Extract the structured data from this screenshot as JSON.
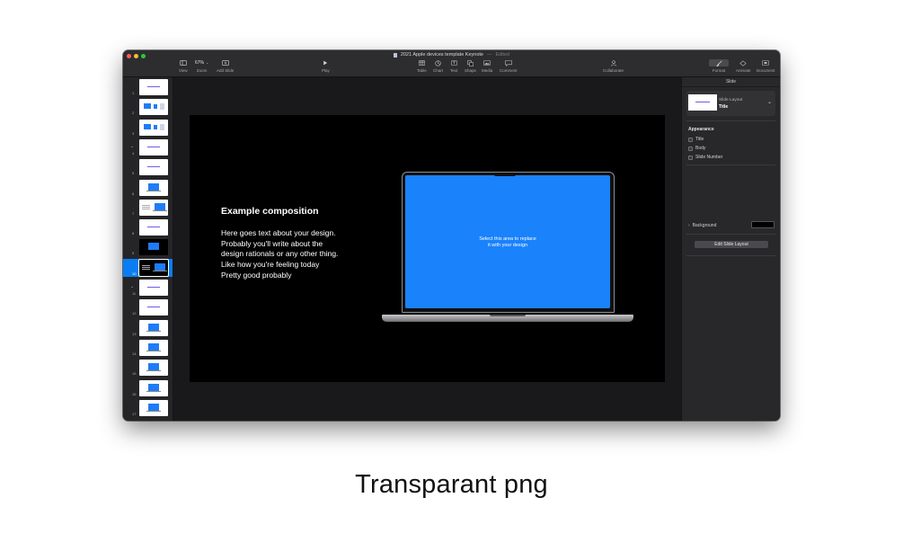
{
  "window": {
    "title": "2021 Apple devices template Keynote",
    "title_separator": "—",
    "status": "Edited",
    "traffic_lights": {
      "close": "#fe5f57",
      "minimize": "#febc2e",
      "zoom": "#28c840"
    }
  },
  "toolbar": {
    "view_label": "View",
    "zoom_value": "67%",
    "zoom_label": "Zoom",
    "add_slide_label": "Add Slide",
    "play_label": "Play",
    "table_label": "Table",
    "chart_label": "Chart",
    "text_label": "Text",
    "shape_label": "Shape",
    "media_label": "Media",
    "comment_label": "Comment",
    "collaborate_label": "Collaborate",
    "format_label": "Format",
    "animate_label": "Animate",
    "document_label": "Document",
    "icons": {
      "view": "sidebar-icon",
      "add_slide": "add-slide-icon",
      "play": "play-icon",
      "table": "table-icon",
      "chart": "chart-icon",
      "text": "text-icon",
      "shape": "shape-icon",
      "media": "media-icon",
      "comment": "comment-icon",
      "collaborate": "collaborate-icon",
      "format": "paintbrush-icon",
      "animate": "animate-icon",
      "document": "document-icon"
    }
  },
  "navigator": {
    "selected_index": 10,
    "slides": [
      {
        "num": "1",
        "kind": "title"
      },
      {
        "num": "2",
        "kind": "devices"
      },
      {
        "num": "3",
        "kind": "devices"
      },
      {
        "num": "4",
        "kind": "section",
        "collapsed_group": true
      },
      {
        "num": "5",
        "kind": "title"
      },
      {
        "num": "6",
        "kind": "laptop"
      },
      {
        "num": "7",
        "kind": "laptop-text"
      },
      {
        "num": "8",
        "kind": "title"
      },
      {
        "num": "9",
        "kind": "dark"
      },
      {
        "num": "10",
        "kind": "dark-laptop"
      },
      {
        "num": "11",
        "kind": "section",
        "collapsed_group": true
      },
      {
        "num": "12",
        "kind": "title"
      },
      {
        "num": "13",
        "kind": "laptop"
      },
      {
        "num": "14",
        "kind": "laptop"
      },
      {
        "num": "15",
        "kind": "laptop"
      },
      {
        "num": "16",
        "kind": "laptop"
      },
      {
        "num": "17",
        "kind": "laptop"
      }
    ]
  },
  "slide": {
    "title": "Example composition",
    "body_lines": [
      "Here goes text about your design.",
      "Probably you'll write about the",
      "design rationals or any other thing.",
      "Like how you're feeling today",
      "Pretty good probably"
    ],
    "screen_text_lines": [
      "Select this area to replace",
      "it with your design"
    ],
    "screen_color": "#1a82fb"
  },
  "inspector": {
    "tab": "Slide",
    "layout_label": "Slide Layout",
    "layout_value": "Title",
    "appearance_title": "Appearance",
    "appearance_options": [
      {
        "label": "Title",
        "checked": false
      },
      {
        "label": "Body",
        "checked": false
      },
      {
        "label": "Slide Number",
        "checked": false
      }
    ],
    "background_label": "Background",
    "background_color": "#000000",
    "edit_layout_button": "Edit Slide Layout"
  },
  "caption": "Transparant png"
}
